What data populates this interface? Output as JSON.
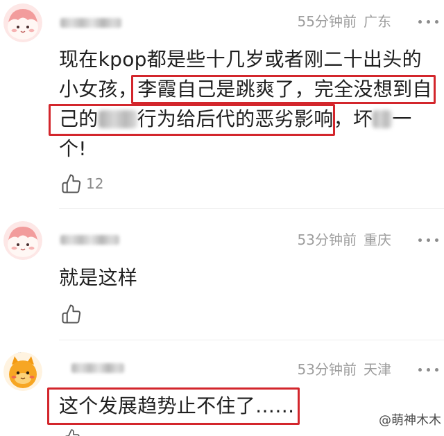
{
  "colors": {
    "highlight_box": "#d3262c",
    "text": "#1f1f1f",
    "meta_text": "#9d9d9d",
    "divider": "#ececec"
  },
  "icons": {
    "like": "thumbs-up-icon",
    "more": "more-dots-icon",
    "avatar": "avatar-icon"
  },
  "comments": [
    {
      "time": "55分钟前",
      "location": "广东",
      "text": {
        "line1": "现在kpop都是些十几岁或者刚二十出头的",
        "line2_plain": "小女孩，",
        "line2_highlight": "李霞自己是跳爽了，完全没想到自",
        "line3_highlight_start": "己的",
        "line3_highlight_end": "行为给后代的恶劣影响",
        "line3_plain": "，坏",
        "line3_tail": "一",
        "line4": "个!"
      },
      "like_count": "12"
    },
    {
      "time": "53分钟前",
      "location": "重庆",
      "text": {
        "line1": "就是这样"
      }
    },
    {
      "time": "53分钟前",
      "location": "天津",
      "text": {
        "line1_highlight": "这个发展趋势止不住了……"
      }
    }
  ],
  "watermark": "@萌神木木"
}
